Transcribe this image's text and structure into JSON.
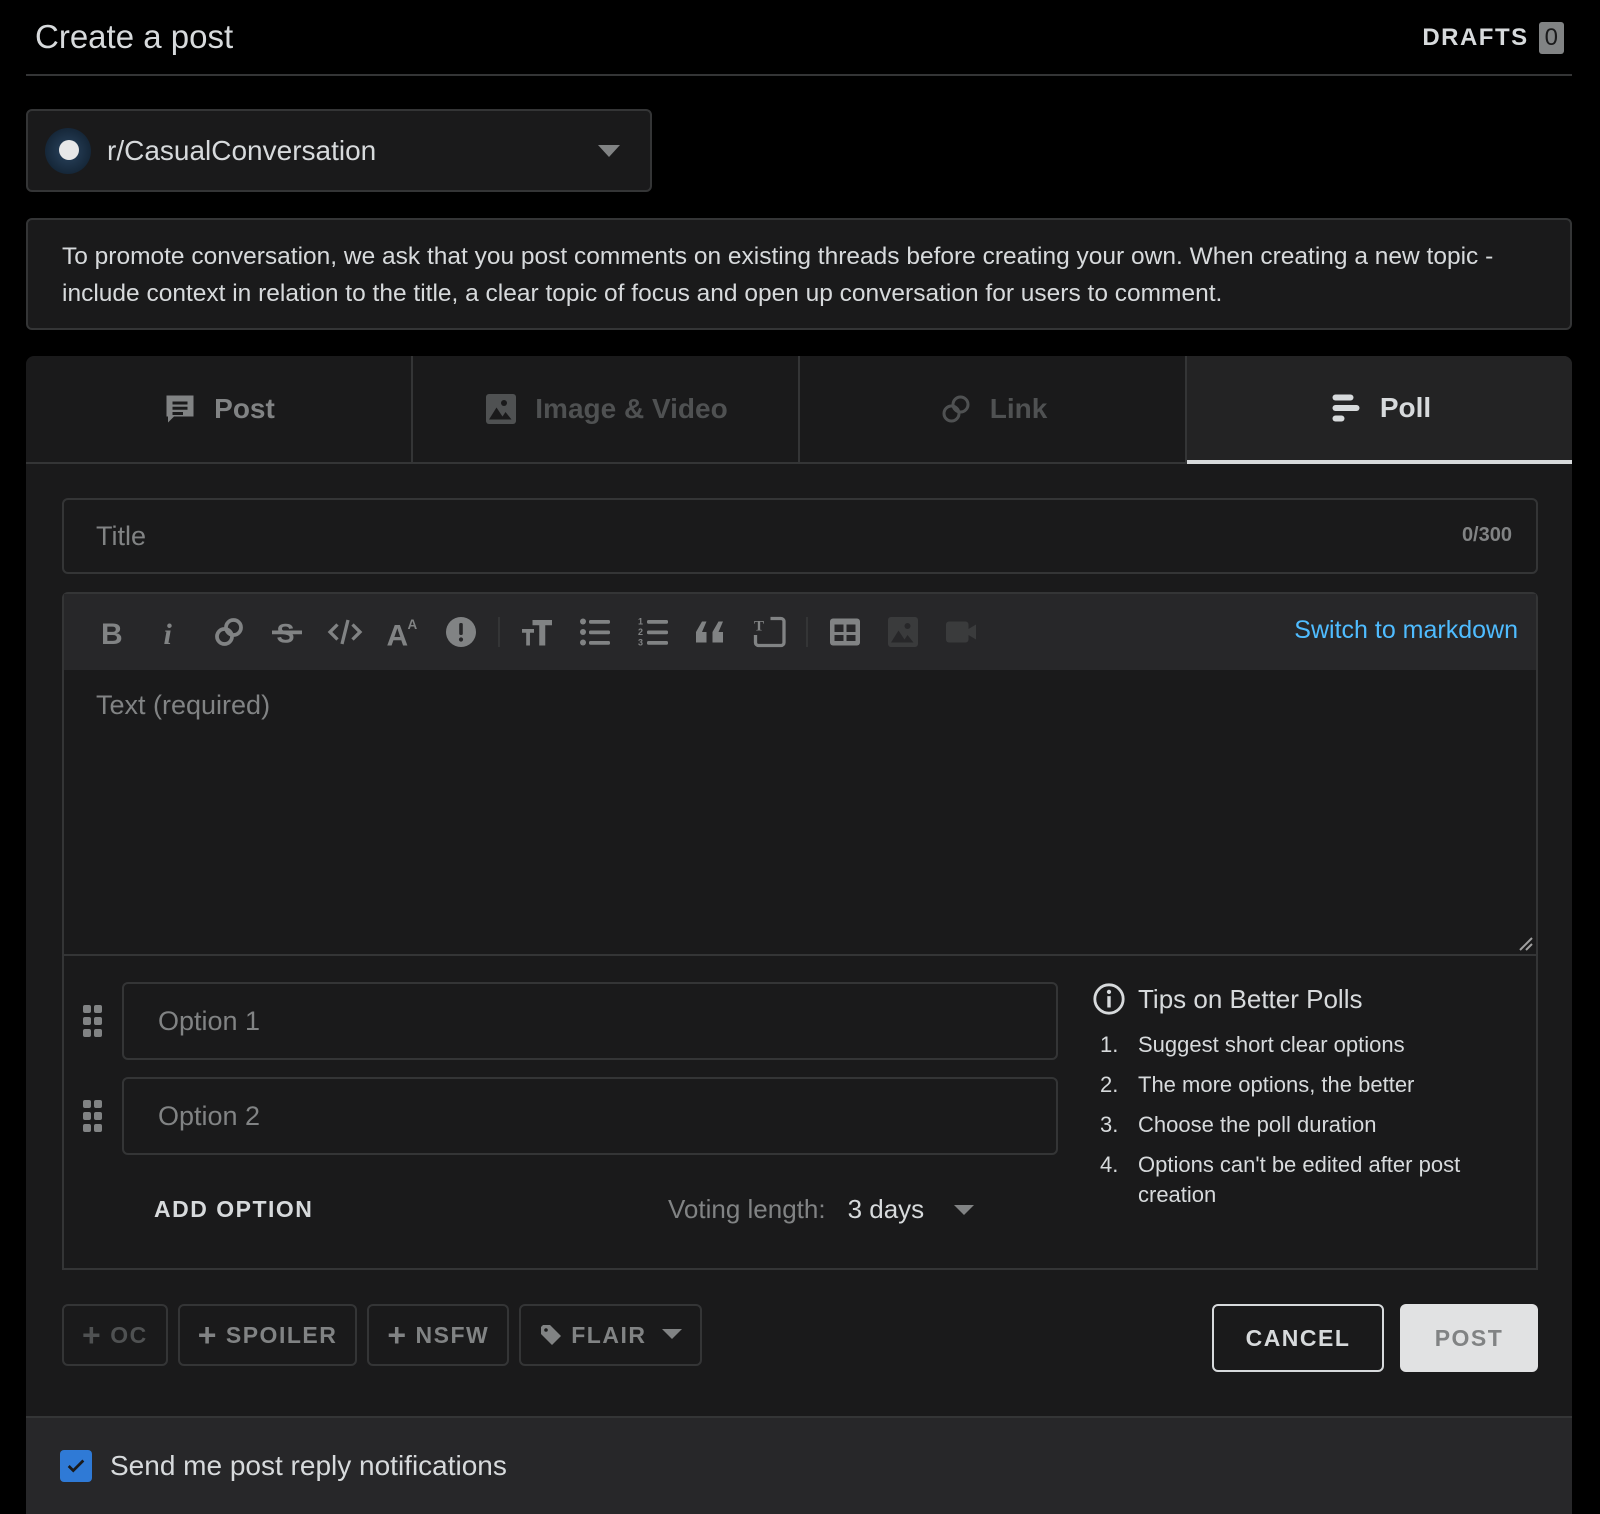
{
  "header": {
    "title": "Create a post",
    "drafts_label": "DRAFTS",
    "drafts_count": "0"
  },
  "community": {
    "name": "r/CasualConversation",
    "icon": "community-avatar"
  },
  "rules_text": "To promote conversation, we ask that you post comments on existing threads before creating your own. When creating a new topic - include context in relation to the title, a clear topic of focus and open up conversation for users to comment.",
  "tabs": [
    {
      "label": "Post",
      "icon": "post-icon",
      "state": "enabled"
    },
    {
      "label": "Image & Video",
      "icon": "image-icon",
      "state": "disabled"
    },
    {
      "label": "Link",
      "icon": "link-icon",
      "state": "disabled"
    },
    {
      "label": "Poll",
      "icon": "poll-icon",
      "state": "active"
    }
  ],
  "title_field": {
    "placeholder": "Title",
    "value": "",
    "counter": "0/300"
  },
  "toolbar": {
    "buttons": [
      "bold",
      "italic",
      "link",
      "strikethrough",
      "inline-code",
      "superscript",
      "spoiler",
      "heading",
      "bulleted-list",
      "numbered-list",
      "quote-block",
      "code-block",
      "table",
      "image",
      "video"
    ],
    "switch_label": "Switch to markdown"
  },
  "body_field": {
    "placeholder": "Text (required)",
    "value": ""
  },
  "poll": {
    "options": [
      {
        "placeholder": "Option 1",
        "value": ""
      },
      {
        "placeholder": "Option 2",
        "value": ""
      }
    ],
    "add_option_label": "ADD OPTION",
    "voting_length_label": "Voting length:",
    "voting_length_value": "3 days"
  },
  "tips": {
    "title": "Tips on Better Polls",
    "items": [
      {
        "num": "1.",
        "text": "Suggest short clear options"
      },
      {
        "num": "2.",
        "text": "The more options, the better"
      },
      {
        "num": "3.",
        "text": "Choose the poll duration"
      },
      {
        "num": "4.",
        "text": "Options can't be edited after post creation"
      }
    ]
  },
  "tags": {
    "oc": "OC",
    "spoiler": "SPOILER",
    "nsfw": "NSFW",
    "flair": "FLAIR"
  },
  "actions": {
    "cancel": "CANCEL",
    "post": "POST"
  },
  "notifications": {
    "label": "Send me post reply notifications",
    "checked": true
  },
  "colors": {
    "accent_link": "#4fbcff",
    "checkbox": "#2f7ad6"
  }
}
